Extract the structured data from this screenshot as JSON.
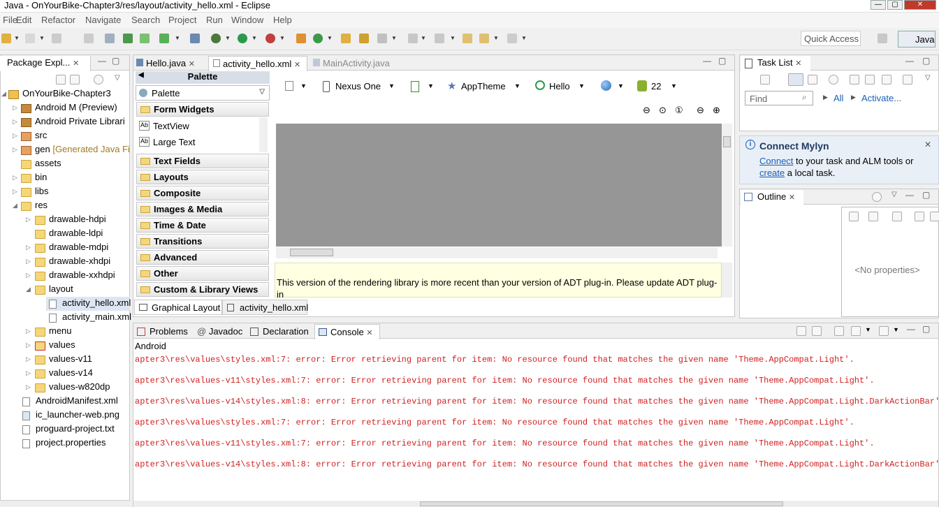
{
  "window": {
    "title": "Java - OnYourBike-Chapter3/res/layout/activity_hello.xml - Eclipse"
  },
  "menu": [
    "File",
    "Edit",
    "Refactor",
    "Navigate",
    "Search",
    "Project",
    "Run",
    "Window",
    "Help"
  ],
  "toolbar": {
    "quick_access": "Quick Access",
    "perspective": "Java"
  },
  "package_explorer": {
    "tab": "Package Expl...",
    "project": "OnYourBike-Chapter3",
    "items": [
      {
        "label": "Android M (Preview)",
        "suffix": ""
      },
      {
        "label": "Android Private Librari",
        "suffix": ""
      },
      {
        "label": "src",
        "suffix": ""
      },
      {
        "label": "gen",
        "suffix": "[Generated Java Fi"
      },
      {
        "label": "assets",
        "suffix": ""
      },
      {
        "label": "bin",
        "suffix": ""
      },
      {
        "label": "libs",
        "suffix": ""
      },
      {
        "label": "res",
        "suffix": ""
      },
      {
        "label": "drawable-hdpi",
        "suffix": ""
      },
      {
        "label": "drawable-ldpi",
        "suffix": ""
      },
      {
        "label": "drawable-mdpi",
        "suffix": ""
      },
      {
        "label": "drawable-xhdpi",
        "suffix": ""
      },
      {
        "label": "drawable-xxhdpi",
        "suffix": ""
      },
      {
        "label": "layout",
        "suffix": ""
      },
      {
        "label": "activity_hello.xml",
        "suffix": ""
      },
      {
        "label": "activity_main.xml",
        "suffix": ""
      },
      {
        "label": "menu",
        "suffix": ""
      },
      {
        "label": "values",
        "suffix": ""
      },
      {
        "label": "values-v11",
        "suffix": ""
      },
      {
        "label": "values-v14",
        "suffix": ""
      },
      {
        "label": "values-w820dp",
        "suffix": ""
      },
      {
        "label": "AndroidManifest.xml",
        "suffix": ""
      },
      {
        "label": "ic_launcher-web.png",
        "suffix": ""
      },
      {
        "label": "proguard-project.txt",
        "suffix": ""
      },
      {
        "label": "project.properties",
        "suffix": ""
      }
    ]
  },
  "editor": {
    "tabs": [
      "Hello.java",
      "activity_hello.xml",
      "MainActivity.java"
    ],
    "palette": {
      "header": "Palette",
      "dropdown": "Palette",
      "open_group": "Form Widgets",
      "widgets": [
        "TextView",
        "Large Text"
      ],
      "groups": [
        "Text Fields",
        "Layouts",
        "Composite",
        "Images & Media",
        "Time & Date",
        "Transitions",
        "Advanced",
        "Other",
        "Custom & Library Views"
      ]
    },
    "config": {
      "device": "Nexus One",
      "theme": "AppTheme",
      "activity": "Hello",
      "api": "22"
    },
    "warning": "This version of the rendering library is more recent than your version of ADT plug-in. Please update ADT plug-in",
    "bottom_tabs": [
      "Graphical Layout",
      "activity_hello.xml"
    ]
  },
  "task_list": {
    "tab": "Task List",
    "find_placeholder": "Find",
    "all": "All",
    "activate": "Activate..."
  },
  "mylyn": {
    "title": "Connect Mylyn",
    "connect": "Connect",
    "text1": " to your task and ALM tools or",
    "create": "create",
    "text2": " a local task."
  },
  "outline": {
    "tab": "Outline",
    "no_props": "<No properties>"
  },
  "console": {
    "tabs": [
      "Problems",
      "Javadoc",
      "Declaration",
      "Console"
    ],
    "label": "Android",
    "lines": [
      "apter3\\res\\values\\styles.xml:7: error: Error retrieving parent for item: No resource found that matches the given name 'Theme.AppCompat.Light'.",
      "apter3\\res\\values-v11\\styles.xml:7: error: Error retrieving parent for item: No resource found that matches the given name 'Theme.AppCompat.Light'.",
      "apter3\\res\\values-v14\\styles.xml:8: error: Error retrieving parent for item: No resource found that matches the given name 'Theme.AppCompat.Light.DarkActionBar'.",
      "apter3\\res\\values\\styles.xml:7: error: Error retrieving parent for item: No resource found that matches the given name 'Theme.AppCompat.Light'.",
      "apter3\\res\\values-v11\\styles.xml:7: error: Error retrieving parent for item: No resource found that matches the given name 'Theme.AppCompat.Light'.",
      "apter3\\res\\values-v14\\styles.xml:8: error: Error retrieving parent for item: No resource found that matches the given name 'Theme.AppCompat.Light.DarkActionBar'."
    ]
  },
  "colors": {
    "error": "#d02020",
    "link": "#1a5fb4",
    "warning_bg": "#ffffe1",
    "canvas": "#969696"
  }
}
